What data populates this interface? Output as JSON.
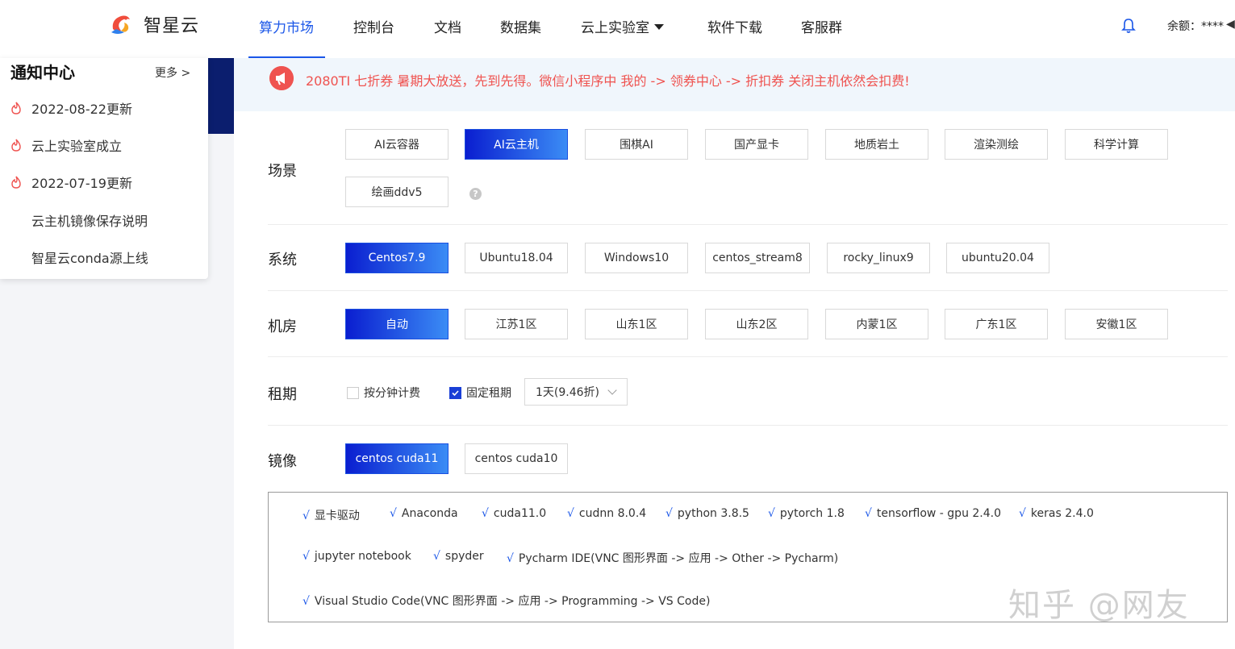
{
  "header": {
    "brand": "智星云",
    "nav": [
      {
        "label": "算力市场",
        "active": true
      },
      {
        "label": "控制台"
      },
      {
        "label": "文档"
      },
      {
        "label": "数据集"
      },
      {
        "label": "云上实验室"
      },
      {
        "label": "软件下载"
      },
      {
        "label": "客服群"
      }
    ],
    "balance": "余额：****",
    "balance_arrow": "◀",
    "accent_color": "#1a56e8"
  },
  "notice": {
    "title": "通知中心",
    "more": "更多 >",
    "items": [
      {
        "label": "2022-08-22更新",
        "icon": "flame-icon"
      },
      {
        "label": "云上实验室成立",
        "icon": "flame-icon"
      },
      {
        "label": "2022-07-19更新",
        "icon": "flame-icon"
      },
      {
        "label": "云主机镜像保存说明"
      },
      {
        "label": "智星云conda源上线"
      }
    ]
  },
  "banner": {
    "text": "2080TI 七折券 暑期大放送，先到先得。微信小程序中 我的 -> 领券中心 -> 折扣券 关闭主机依然会扣费!",
    "color": "#ef5350",
    "icon": "megaphone-icon"
  },
  "scene": {
    "label": "场景",
    "options": [
      "AI云容器",
      "AI云主机",
      "围棋AI",
      "国产显卡",
      "地质岩土",
      "渲染测绘",
      "科学计算",
      "绘画ddv5"
    ],
    "selected": "AI云主机",
    "help": "?"
  },
  "system": {
    "label": "系统",
    "options": [
      "Centos7.9",
      "Ubuntu18.04",
      "Windows10",
      "centos_stream8",
      "rocky_linux9",
      "ubuntu20.04"
    ],
    "selected": "Centos7.9"
  },
  "room": {
    "label": "机房",
    "options": [
      "自动",
      "江苏1区",
      "山东1区",
      "山东2区",
      "内蒙1区",
      "广东1区",
      "安徽1区"
    ],
    "selected": "自动"
  },
  "rent": {
    "label": "租期",
    "per_minute": {
      "label": "按分钟计费",
      "checked": false
    },
    "fixed": {
      "label": "固定租期",
      "checked": true
    },
    "duration": "1天(9.46折)"
  },
  "image": {
    "label": "镜像",
    "options": [
      "centos cuda11",
      "centos cuda10"
    ],
    "selected": "centos cuda11"
  },
  "software": {
    "tick": "√",
    "rows": [
      [
        "显卡驱动",
        "Anaconda",
        "cuda11.0",
        "cudnn 8.0.4",
        "python 3.8.5",
        "pytorch 1.8",
        "tensorflow - gpu 2.4.0",
        "keras 2.4.0"
      ],
      [
        "jupyter notebook",
        "spyder",
        "Pycharm IDE(VNC 图形界面 -> 应用 -> Other -> Pycharm)"
      ],
      [
        "Visual Studio Code(VNC 图形界面 -> 应用 -> Programming -> VS Code)"
      ]
    ]
  },
  "watermark": "知乎 @网友"
}
